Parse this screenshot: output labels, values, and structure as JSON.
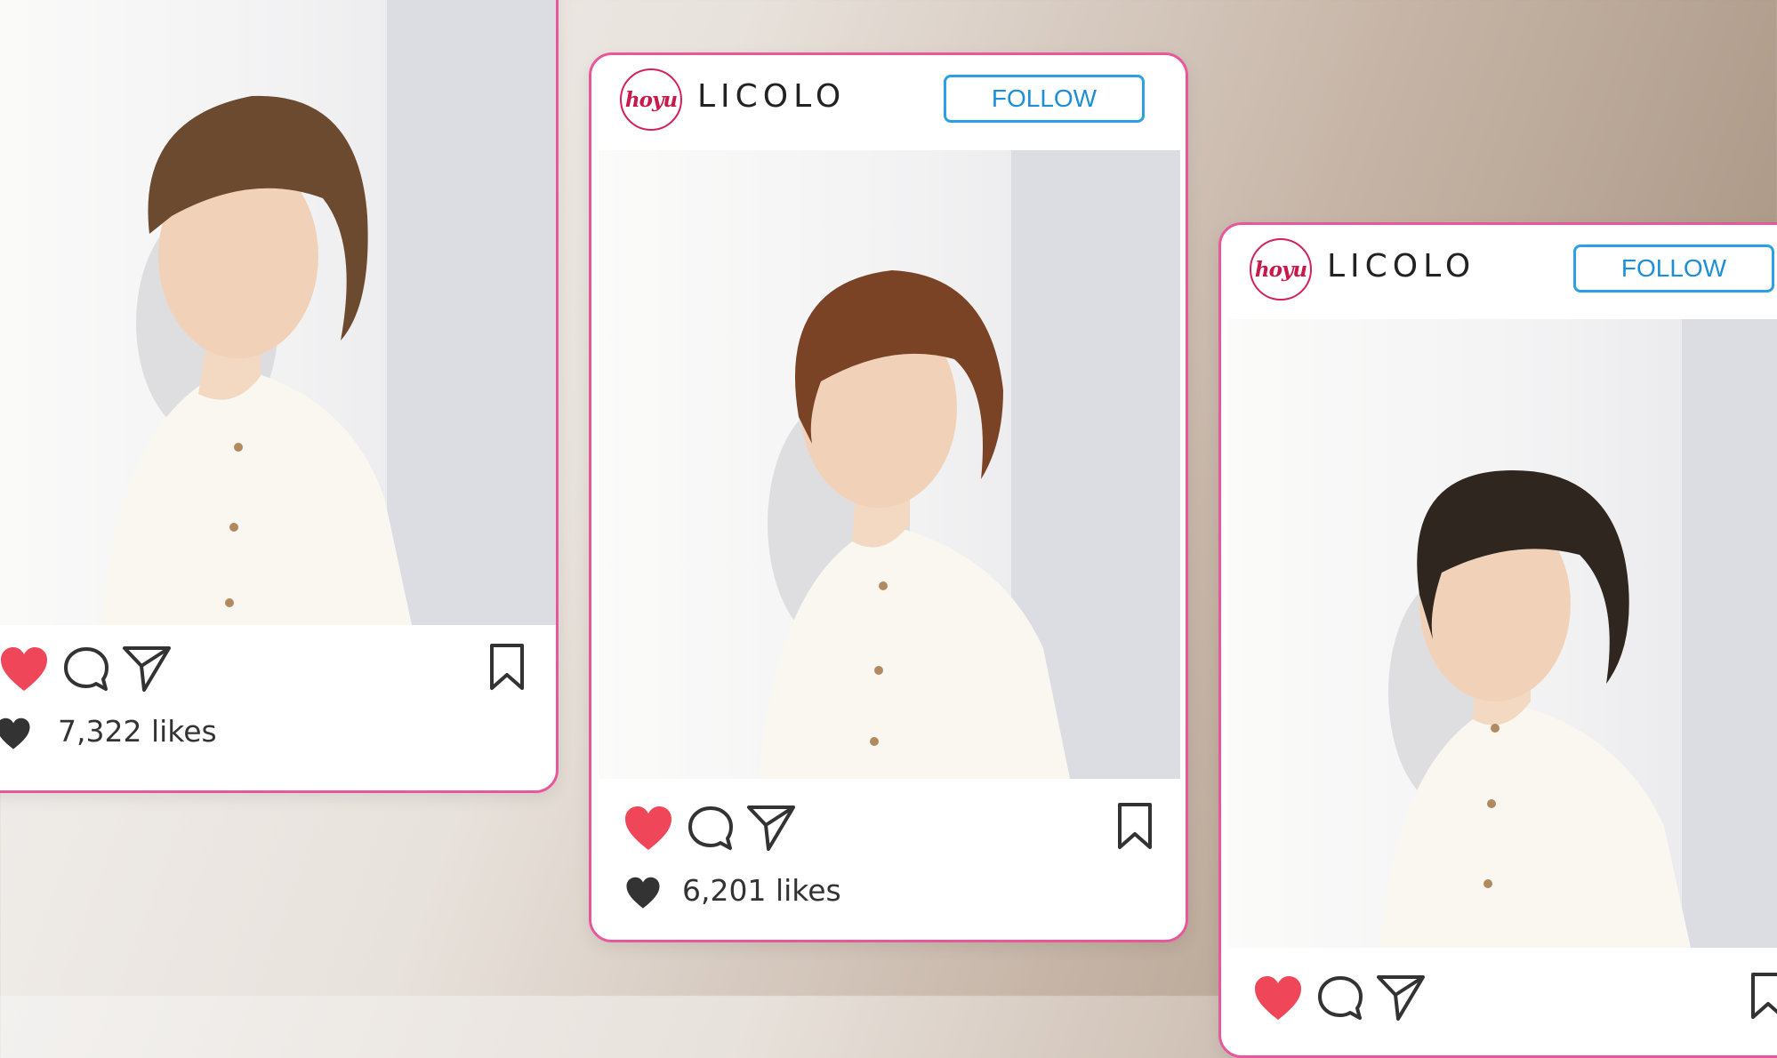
{
  "posts": [
    {
      "id": "left",
      "likes_text": "7,322 likes",
      "hair_color": "#6b4a30"
    },
    {
      "id": "center",
      "brand_logo_text": "hoyu",
      "brand_name": "LICOLO",
      "follow_label": "FOLLOW",
      "likes_text": "6,201 likes",
      "hair_color": "#7a4326"
    },
    {
      "id": "right",
      "brand_logo_text": "hoyu",
      "brand_name": "LICOLO",
      "follow_label": "FOLLOW",
      "hair_color": "#2f2620"
    }
  ],
  "icons": [
    "heart-icon",
    "comment-icon",
    "share-icon",
    "bookmark-icon",
    "likes-heart-icon"
  ],
  "colors": {
    "card_border": "#e8579c",
    "like_red": "#f0465a",
    "follow_blue": "#2ba0e2",
    "logo_red": "#c9184a"
  }
}
